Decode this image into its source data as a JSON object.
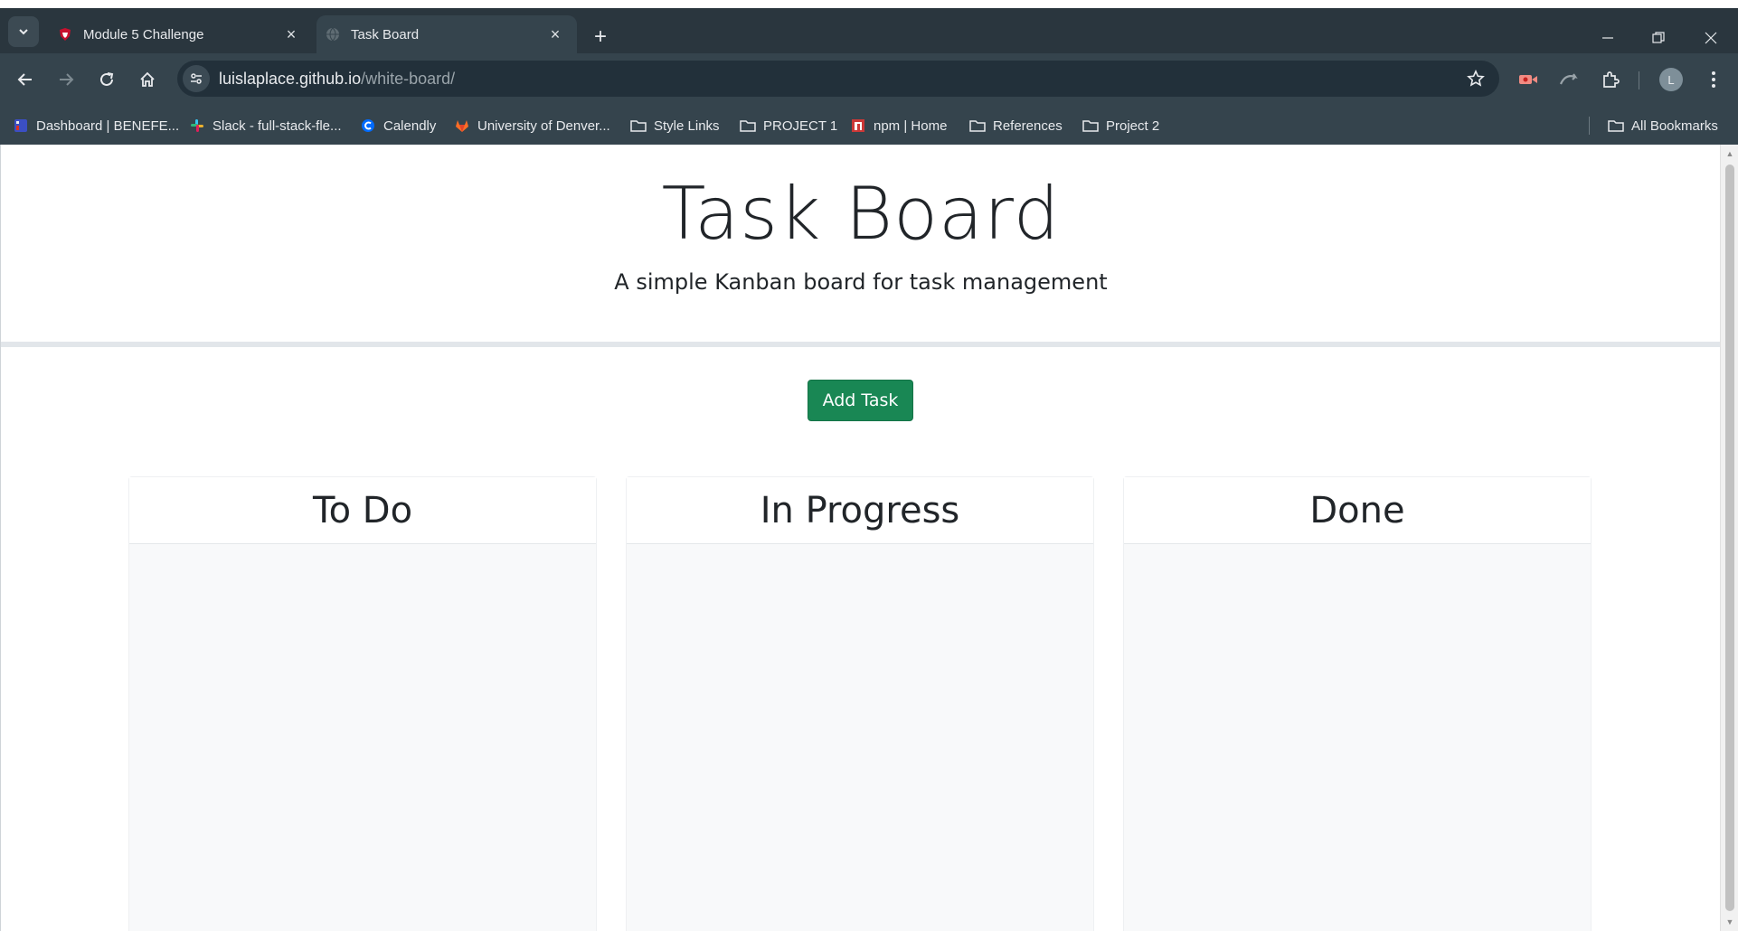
{
  "browser": {
    "tabs": [
      {
        "title": "Module 5 Challenge",
        "active": false,
        "favicon": "shield-icon"
      },
      {
        "title": "Task Board",
        "active": true,
        "favicon": "globe-icon"
      }
    ],
    "url_host": "luislaplace.github.io",
    "url_path": "/white-board/",
    "profile_initial": "L",
    "bookmarks": [
      {
        "label": "Dashboard | BENEFE...",
        "icon": "dashboard-favicon"
      },
      {
        "label": "Slack - full-stack-fle...",
        "icon": "slack-icon"
      },
      {
        "label": "Calendly",
        "icon": "calendly-icon"
      },
      {
        "label": "University of Denver...",
        "icon": "gitlab-icon"
      },
      {
        "label": "Style Links",
        "icon": "folder-icon"
      },
      {
        "label": "PROJECT 1",
        "icon": "folder-icon"
      },
      {
        "label": "npm | Home",
        "icon": "npm-icon"
      },
      {
        "label": "References",
        "icon": "folder-icon"
      },
      {
        "label": "Project 2",
        "icon": "folder-icon"
      }
    ],
    "all_bookmarks_label": "All Bookmarks"
  },
  "page": {
    "title": "Task Board",
    "subtitle": "A simple Kanban board for task management",
    "add_task_label": "Add Task",
    "lanes": [
      {
        "title": "To Do"
      },
      {
        "title": "In Progress"
      },
      {
        "title": "Done"
      }
    ]
  },
  "colors": {
    "add_button": "#198754",
    "chrome_bg": "#35444d",
    "lane_bg": "#f8f9fa"
  }
}
